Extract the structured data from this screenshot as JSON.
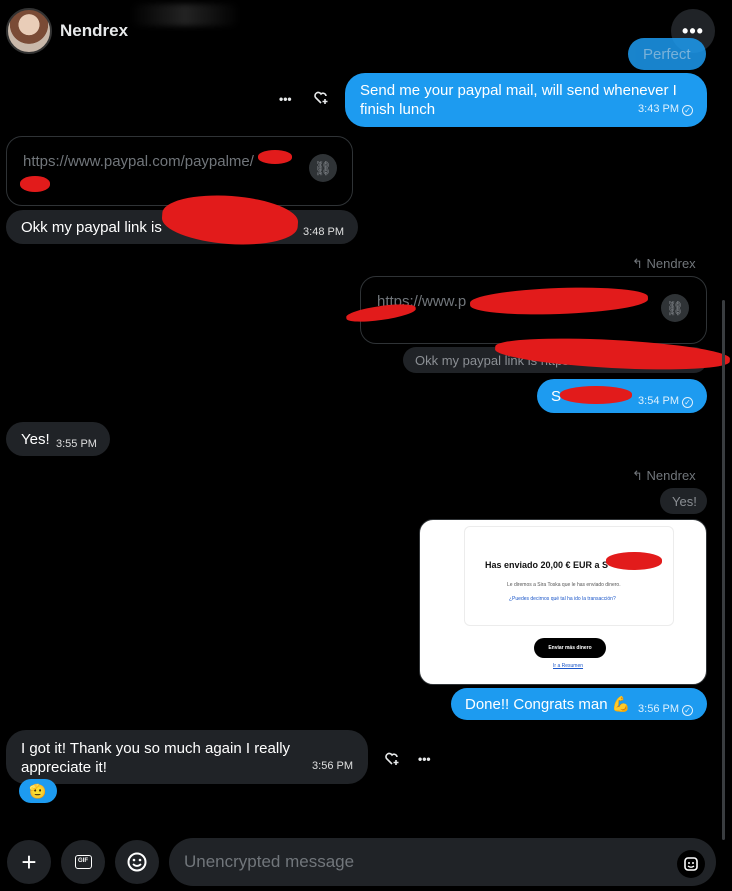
{
  "header": {
    "contact_name": "Nendrex",
    "more_glyph": "•••"
  },
  "messages": {
    "perfect": {
      "text": "Perfect"
    },
    "m1": {
      "text": "Send me your paypal mail, will send whenever I finish lunch",
      "time": "3:43 PM"
    },
    "m2": {
      "link": "https://www.paypal.com/paypalme/",
      "text": "Okk my paypal link is",
      "time": "3:48 PM"
    },
    "m3": {
      "reply_to": "Nendrex",
      "link": "https://www.p",
      "quoted": "Okk my paypal link is https://",
      "text": "S",
      "time": "3:54 PM"
    },
    "m4": {
      "text": "Yes!",
      "time": "3:55 PM"
    },
    "m5": {
      "reply_to": "Nendrex",
      "quoted": "Yes!",
      "text": "Done!! Congrats man 💪",
      "time": "3:56 PM",
      "receipt": {
        "title": "Has enviado 20,00 € EUR a S",
        "subtitle": "Le diremos a Sira Toska que le has enviado dinero.",
        "link": "¿Puedes decirnos qué tal ha ido la transacción?",
        "button": "Enviar más dinero",
        "back": "Ir a Resumen"
      }
    },
    "m6": {
      "text": "I got it! Thank you so much again I really appreciate it!",
      "time": "3:56 PM",
      "reaction": "🫡"
    }
  },
  "actions": {
    "more": "•••",
    "react": "♡+"
  },
  "composer": {
    "placeholder": "Unencrypted message",
    "plus": "+",
    "gif": "GIF"
  },
  "colors": {
    "accent": "#1d9bf0",
    "bubble_in": "#202327",
    "redaction": "#e21b1b"
  },
  "icons": [
    "plus-icon",
    "gif-icon",
    "emoji-icon",
    "link-icon",
    "reply-icon",
    "heart-plus-icon",
    "ellipsis-icon",
    "check-circle-icon",
    "sticker-icon"
  ]
}
